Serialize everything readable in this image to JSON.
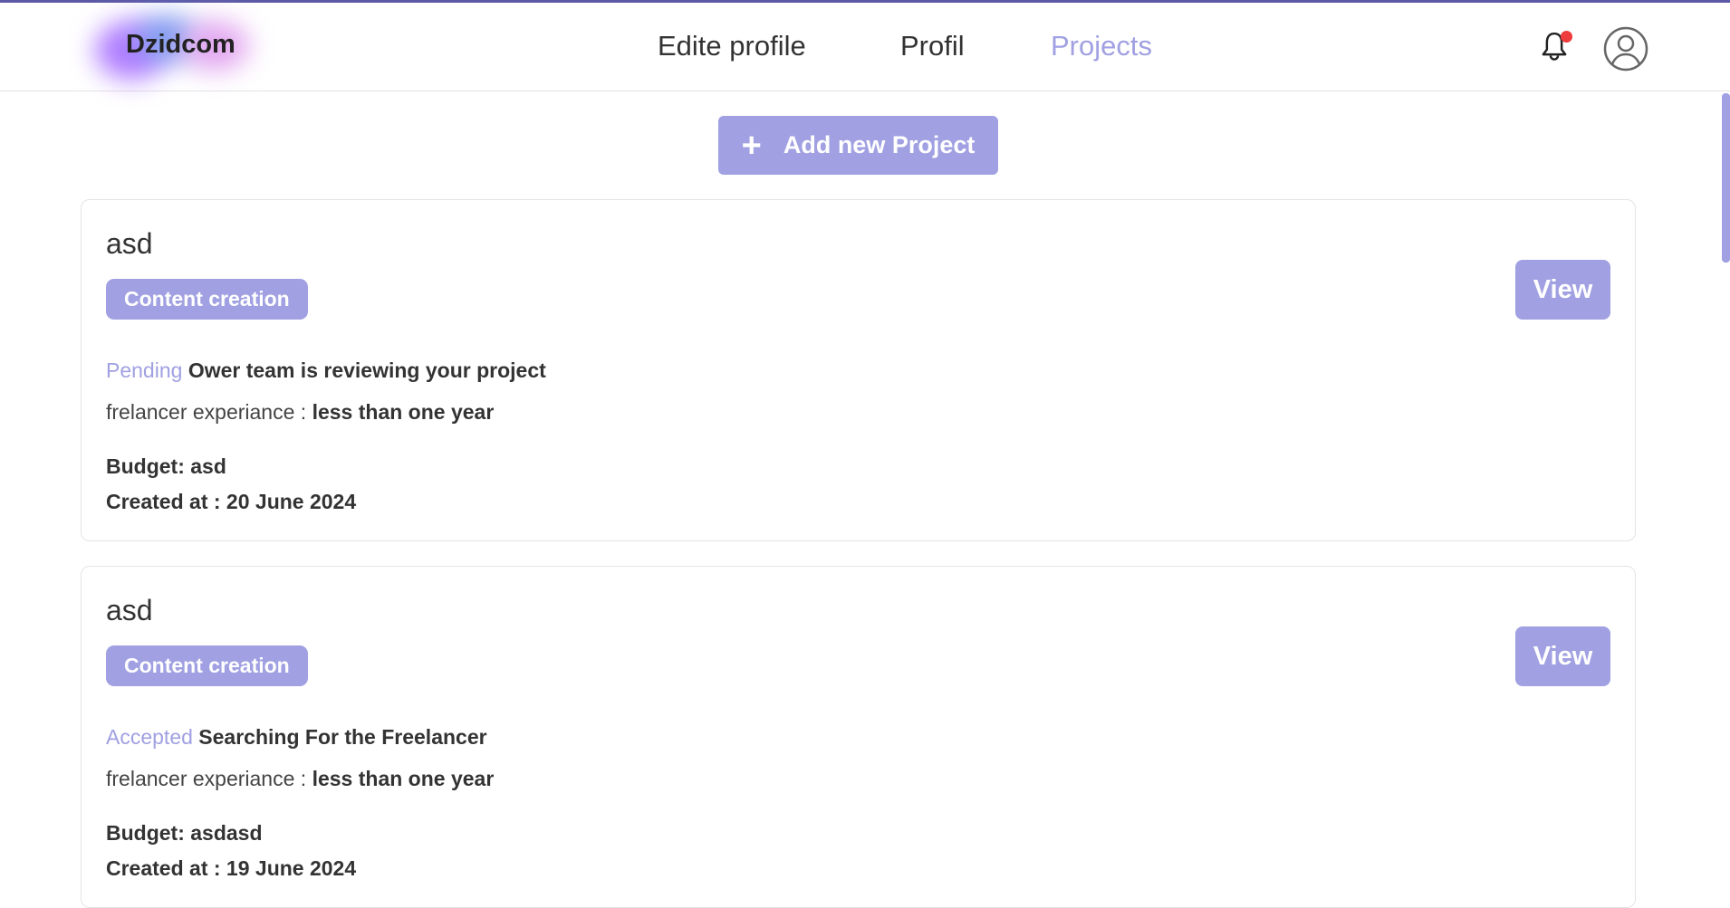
{
  "header": {
    "logo": "Dzidcom",
    "nav": [
      {
        "label": "Edite profile",
        "active": false
      },
      {
        "label": "Profil",
        "active": false
      },
      {
        "label": "Projects",
        "active": true
      }
    ],
    "icons": [
      "bell-icon",
      "user-avatar-icon"
    ]
  },
  "add_button": {
    "icon": "plus-icon",
    "label": "Add new Project"
  },
  "projects": [
    {
      "title": "asd",
      "category": "Content creation",
      "status": "Pending",
      "status_text": "Ower team is reviewing your project",
      "experience_label": "frelancer experiance :",
      "experience_value": "less than one year",
      "budget": "Budget: asd",
      "created": "Created at : 20 June 2024",
      "view_label": "View"
    },
    {
      "title": "asd",
      "category": "Content creation",
      "status": "Accepted",
      "status_text": "Searching For the Freelancer",
      "experience_label": "frelancer experiance :",
      "experience_value": "less than one year",
      "budget": "Budget: asdasd",
      "created": "Created at : 19 June 2024",
      "view_label": "View"
    }
  ],
  "colors": {
    "accent": "#a0a0e2",
    "notification": "#ee3b3b",
    "topbar": "#5c5aa6"
  }
}
